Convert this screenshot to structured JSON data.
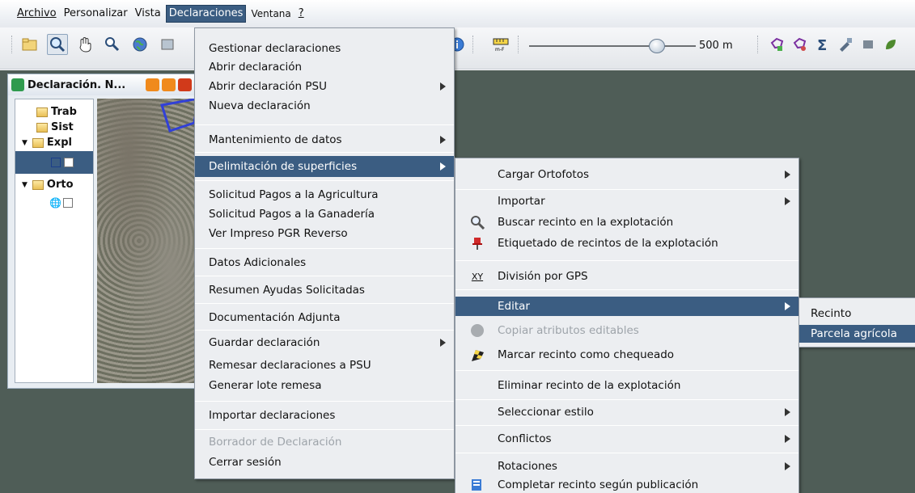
{
  "menubar": {
    "items": [
      {
        "label": "Archivo"
      },
      {
        "label": "Personalizar"
      },
      {
        "label": "Vista"
      },
      {
        "label": "Declaraciones"
      },
      {
        "label": "Ventana"
      },
      {
        "label": "?"
      }
    ]
  },
  "toolbar": {
    "scale_value": "500 m",
    "slider_level": 0.72
  },
  "inner_window": {
    "title": "Declaración. N...",
    "tree": [
      "Trab",
      "Sist",
      "Expl",
      "Orto"
    ]
  },
  "declaraciones_menu": {
    "items": [
      {
        "label": "Gestionar declaraciones"
      },
      {
        "label": "Abrir declaración"
      },
      {
        "label": "Abrir declaración PSU"
      },
      {
        "label": "Nueva declaración"
      },
      {
        "label": "Mantenimiento de datos"
      },
      {
        "label": "Delimitación de superficies"
      },
      {
        "label": "Solicitud Pagos a la Agricultura"
      },
      {
        "label": "Solicitud Pagos a la Ganadería"
      },
      {
        "label": "Ver Impreso PGR Reverso"
      },
      {
        "label": "Datos Adicionales"
      },
      {
        "label": "Resumen Ayudas Solicitadas"
      },
      {
        "label": "Documentación Adjunta"
      },
      {
        "label": "Guardar declaración"
      },
      {
        "label": "Remesar declaraciones a PSU"
      },
      {
        "label": "Generar lote remesa"
      },
      {
        "label": "Importar declaraciones"
      },
      {
        "label": "Borrador de Declaración"
      },
      {
        "label": "Cerrar sesión"
      }
    ]
  },
  "delimitacion_menu": {
    "items": [
      {
        "label": "Cargar Ortofotos"
      },
      {
        "label": "Importar"
      },
      {
        "label": "Buscar recinto en la explotación"
      },
      {
        "label": "Etiquetado de recintos de la explotación"
      },
      {
        "label": "División por GPS"
      },
      {
        "label": "Editar"
      },
      {
        "label": "Copiar atributos editables"
      },
      {
        "label": "Marcar recinto como chequeado"
      },
      {
        "label": "Eliminar recinto de la explotación"
      },
      {
        "label": "Seleccionar estilo"
      },
      {
        "label": "Conflictos"
      },
      {
        "label": "Rotaciones"
      },
      {
        "label": "Completar recinto según publicación"
      }
    ]
  },
  "editar_menu": {
    "items": [
      {
        "label": "Recinto"
      },
      {
        "label": "Parcela agrícola"
      }
    ]
  },
  "colors": {
    "highlight": "#3b5d82",
    "menu_bg": "#eceef1",
    "workspace": "#4f5d57"
  }
}
